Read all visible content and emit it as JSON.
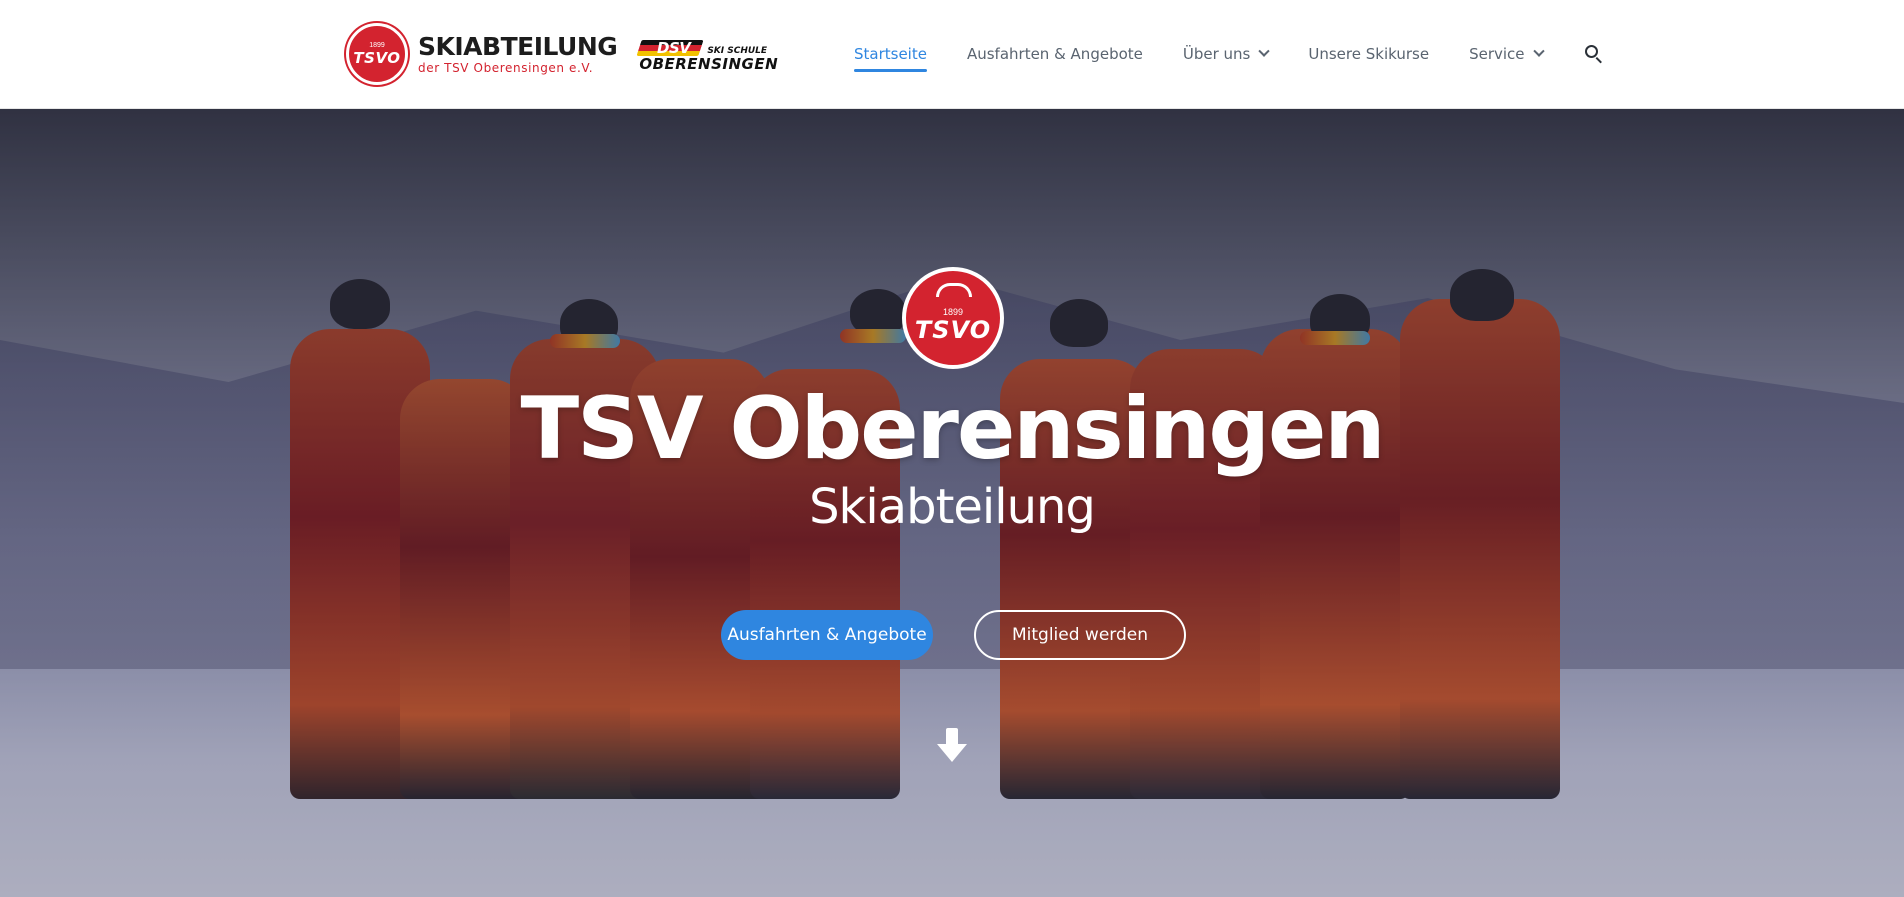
{
  "header": {
    "brand": {
      "badge_year": "1899",
      "badge_text": "TSVO",
      "title": "SKIABTEILUNG",
      "subtitle": "der TSV Oberensingen e.V.",
      "partner_mark": "DSV",
      "partner_top": "SKI SCHULE",
      "partner_bottom": "OBERENSINGEN"
    },
    "nav": [
      {
        "label": "Startseite",
        "active": true,
        "dropdown": false
      },
      {
        "label": "Ausfahrten & Angebote",
        "active": false,
        "dropdown": false
      },
      {
        "label": "Über uns",
        "active": false,
        "dropdown": true
      },
      {
        "label": "Unsere Skikurse",
        "active": false,
        "dropdown": false
      },
      {
        "label": "Service",
        "active": false,
        "dropdown": true
      }
    ],
    "search_icon": "search-icon"
  },
  "hero": {
    "logo_year": "1899",
    "logo_text": "TSVO",
    "title": "TSV Oberensingen",
    "subtitle": "Skiabteilung",
    "primary_button": "Ausfahrten & Angebote",
    "secondary_button": "Mitglied werden",
    "scroll_icon": "arrow-down-icon"
  },
  "colors": {
    "accent": "#2f86e0",
    "brand_red": "#d3232f",
    "nav_text": "#5a6470"
  }
}
